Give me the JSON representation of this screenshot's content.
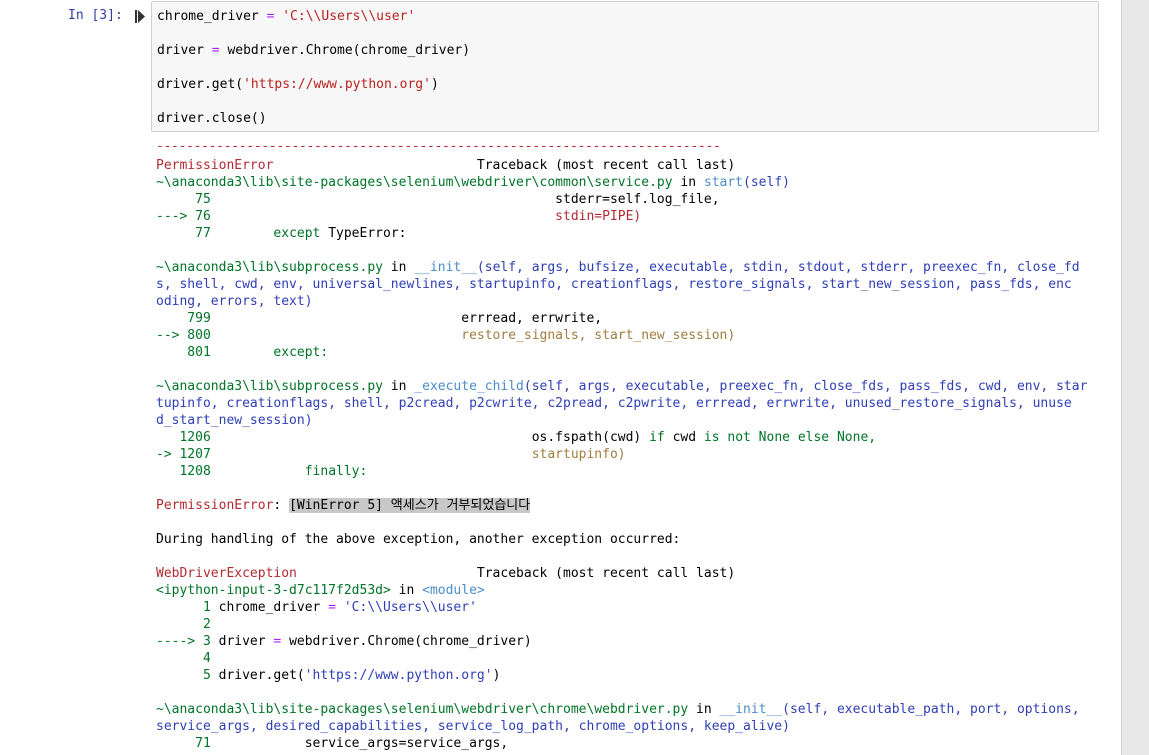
{
  "cell": {
    "prompt": "In [3]:",
    "code": [
      {
        "a": "chrome_driver ",
        "op": "=",
        "b": " ",
        "s": "'C:\\\\Users\\\\user'",
        "c": ""
      },
      {
        "a": "",
        "op": "",
        "b": "",
        "s": "",
        "c": ""
      },
      {
        "a": "driver ",
        "op": "=",
        "b": " webdriver.Chrome(chrome_driver)",
        "s": "",
        "c": ""
      },
      {
        "a": "",
        "op": "",
        "b": "",
        "s": "",
        "c": ""
      },
      {
        "a": "driver.get(",
        "op": "",
        "b": "",
        "s": "'https://www.python.org'",
        "c": ")"
      },
      {
        "a": "",
        "op": "",
        "b": "",
        "s": "",
        "c": ""
      },
      {
        "a": "driver.close()",
        "op": "",
        "b": "",
        "s": "",
        "c": ""
      }
    ]
  },
  "output": {
    "dashes": "---------------------------------------------------------------------------",
    "err1_name": "PermissionError",
    "err1_tb": "                          Traceback (most recent call last)",
    "f1_path": "~\\anaconda3\\lib\\site-packages\\selenium\\webdriver\\common\\service.py",
    "f1_in": " in ",
    "f1_func": "start",
    "f1_args": "(self)",
    "f1_l75_no": "     75",
    "f1_l75_code": "                                            stderr=self.log_file,",
    "f1_l76_arrow": "---> 76",
    "f1_l76_code": "                                            stdin=PIPE)",
    "f1_l77_no": "     77",
    "f1_l77_kw": "        except",
    "f1_l77_code": " TypeError:",
    "f2_path": "~\\anaconda3\\lib\\subprocess.py",
    "f2_in": " in ",
    "f2_func": "__init__",
    "f2_args_1": "(self, args, bufsize, executable, stdin, stdout, stderr, preexec_fn, close_fd",
    "f2_args_2": "s, shell, cwd, env, universal_newlines, startupinfo, creationflags, restore_signals, start_new_session, pass_fds, enc",
    "f2_args_3": "oding, errors, text)",
    "f2_l799_no": "    799",
    "f2_l799_code": "                                errread, errwrite,",
    "f2_l800_arrow": "--> 800",
    "f2_l800_code": "                                restore_signals, start_new_session)",
    "f2_l801_no": "    801",
    "f2_l801_kw": "        except:",
    "f3_path": "~\\anaconda3\\lib\\subprocess.py",
    "f3_in": " in ",
    "f3_func": "_execute_child",
    "f3_args_1": "(self, args, executable, preexec_fn, close_fds, pass_fds, cwd, env, star",
    "f3_args_2": "tupinfo, creationflags, shell, p2cread, p2cwrite, c2pread, c2pwrite, errread, errwrite, unused_restore_signals, unuse",
    "f3_args_3": "d_start_new_session)",
    "f3_l1206_no": "   1206",
    "f3_l1206_a": "                                         os.fspath(cwd) ",
    "f3_l1206_if": "if",
    "f3_l1206_b": " cwd ",
    "f3_l1206_is": "is not",
    "f3_l1206_c": " None ",
    "f3_l1206_else": "else",
    "f3_l1206_d": " None,",
    "f3_l1207_arrow": "-> 1207",
    "f3_l1207_code": "                                         startupinfo)",
    "f3_l1208_no": "   1208",
    "f3_l1208_kw": "            finally:",
    "perm_name": "PermissionError",
    "perm_colon": ": ",
    "perm_msg": "[WinError 5] 액세스가 거부되었습니다",
    "during": "During handling of the above exception, another exception occurred:",
    "err2_name": "WebDriverException",
    "err2_tb": "                       Traceback (most recent call last)",
    "ipy_input": "<ipython-input-3-d7c117f2d53d>",
    "ipy_in": " in ",
    "ipy_module": "<module>",
    "ip_l1_no": "      1",
    "ip_l1_a": " chrome_driver ",
    "ip_l1_op": "=",
    "ip_l1_s": " 'C:\\\\Users\\\\user'",
    "ip_l2_no": "      2",
    "ip_l3_arrow": "----> 3",
    "ip_l3_a": " driver ",
    "ip_l3_op": "=",
    "ip_l3_b": " webdriver.Chrome(chrome_driver)",
    "ip_l4_no": "      4",
    "ip_l5_no": "      5",
    "ip_l5_a": " driver.get(",
    "ip_l5_s": "'https://www.python.org'",
    "ip_l5_c": ")",
    "f4_path": "~\\anaconda3\\lib\\site-packages\\selenium\\webdriver\\chrome\\webdriver.py",
    "f4_in": " in ",
    "f4_func": "__init__",
    "f4_args_1": "(self, executable_path, port, options,",
    "f4_args_2": "service_args, desired_capabilities, service_log_path, chrome_options, keep_alive)",
    "f4_l71_no": "     71",
    "f4_l71_code": "            service_args=service_args,"
  },
  "colors": {
    "prompt": "#303f9f",
    "error": "#b22b31",
    "lineno": "#007427",
    "path": "#2f3fb5",
    "func": "#4d8cc9",
    "arg": "#a07c3f"
  }
}
